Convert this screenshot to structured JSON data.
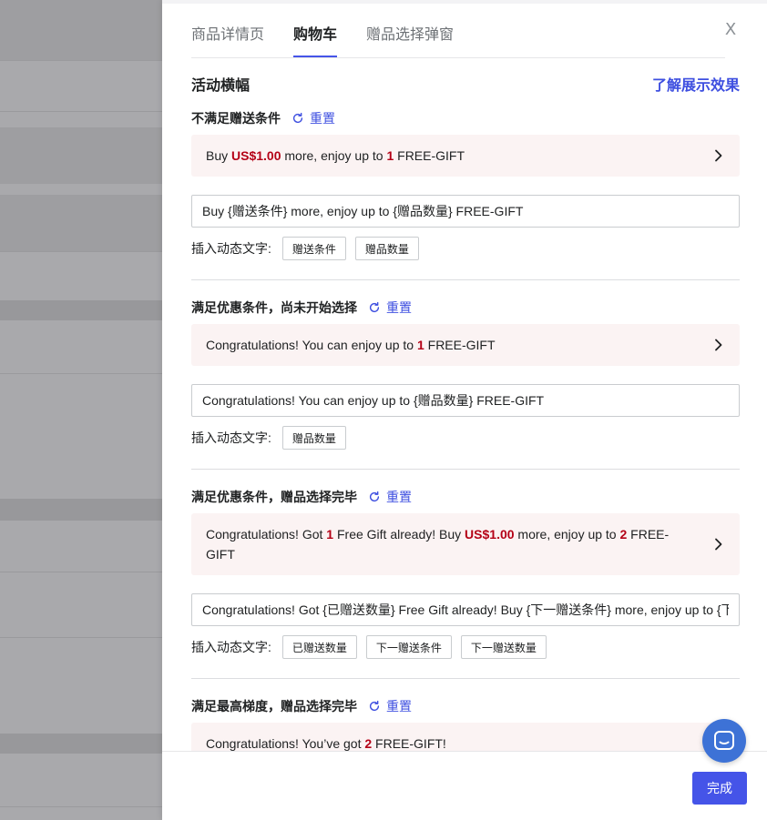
{
  "tabs": [
    {
      "label": "商品详情页"
    },
    {
      "label": "购物车"
    },
    {
      "label": "赠品选择弹窗"
    }
  ],
  "close_label": "X",
  "banner": {
    "title": "活动横幅",
    "learn_more": "了解展示效果"
  },
  "reset_label": "重置",
  "insert_label": "插入动态文字:",
  "sections": [
    {
      "title": "不满足赠送条件",
      "preview": {
        "p1": "Buy ",
        "h1": "US$1.00",
        "p2": " more, enjoy up to ",
        "h2": "1",
        "p3": " FREE-GIFT"
      },
      "input_value": "Buy {赠送条件} more, enjoy up to {赠品数量} FREE-GIFT",
      "chips": [
        "赠送条件",
        "赠品数量"
      ]
    },
    {
      "title": "满足优惠条件，尚未开始选择",
      "preview": {
        "p1": "Congratulations! You can enjoy up to ",
        "h1": "1",
        "p2": " FREE-GIFT"
      },
      "input_value": "Congratulations! You can enjoy up to {赠品数量} FREE-GIFT",
      "chips": [
        "赠品数量"
      ]
    },
    {
      "title": "满足优惠条件，赠品选择完毕",
      "preview": {
        "p1": "Congratulations! Got ",
        "h1": "1",
        "p2": " Free Gift already! Buy ",
        "h2": "US$1.00",
        "p3": " more, enjoy up to ",
        "h3": "2",
        "p4": " FREE-GIFT"
      },
      "input_value": "Congratulations! Got {已赠送数量} Free Gift already! Buy {下一赠送条件} more, enjoy up to {下一赠送数量} FREE-GIFT",
      "chips": [
        "已赠送数量",
        "下一赠送条件",
        "下一赠送数量"
      ]
    },
    {
      "title": "满足最高梯度，赠品选择完毕",
      "preview": {
        "p1": "Congratulations! You’ve got ",
        "h1": "2",
        "p2": " FREE-GIFT!"
      }
    }
  ],
  "footer": {
    "done_label": "完成"
  },
  "colors": {
    "accent": "#4554e8",
    "highlight": "#b40016",
    "preview_bg": "#fbf3f3"
  },
  "icons": [
    "close-icon",
    "reset-icon",
    "chevron-right-icon",
    "chat-icon"
  ]
}
